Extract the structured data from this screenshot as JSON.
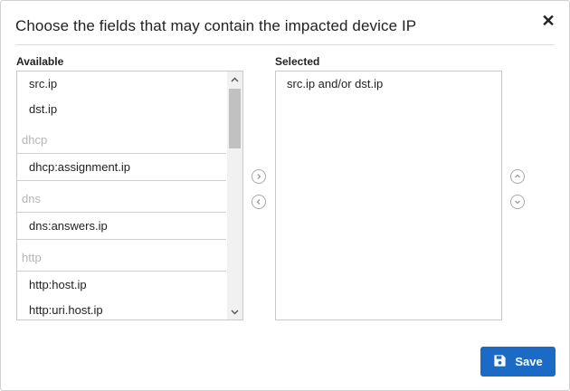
{
  "dialog": {
    "title": "Choose the fields that may contain the impacted device IP",
    "close_icon": "close-icon"
  },
  "available": {
    "label": "Available",
    "items": [
      {
        "type": "option",
        "label": "src.ip"
      },
      {
        "type": "option",
        "label": "dst.ip"
      },
      {
        "type": "group",
        "label": "dhcp"
      },
      {
        "type": "option",
        "label": "dhcp:assignment.ip"
      },
      {
        "type": "group",
        "label": "dns"
      },
      {
        "type": "option",
        "label": "dns:answers.ip"
      },
      {
        "type": "group",
        "label": "http"
      },
      {
        "type": "option",
        "label": "http:host.ip"
      },
      {
        "type": "option",
        "label": "http:uri.host.ip"
      }
    ]
  },
  "selected": {
    "label": "Selected",
    "items": [
      "src.ip and/or dst.ip"
    ]
  },
  "transfer": {
    "add_icon": "chevron-right-circle-icon",
    "remove_icon": "chevron-left-circle-icon"
  },
  "order": {
    "up_icon": "chevron-up-circle-icon",
    "down_icon": "chevron-down-circle-icon"
  },
  "footer": {
    "save_label": "Save",
    "save_icon": "floppy-disk-icon",
    "accent_color": "#1b6bc6"
  }
}
